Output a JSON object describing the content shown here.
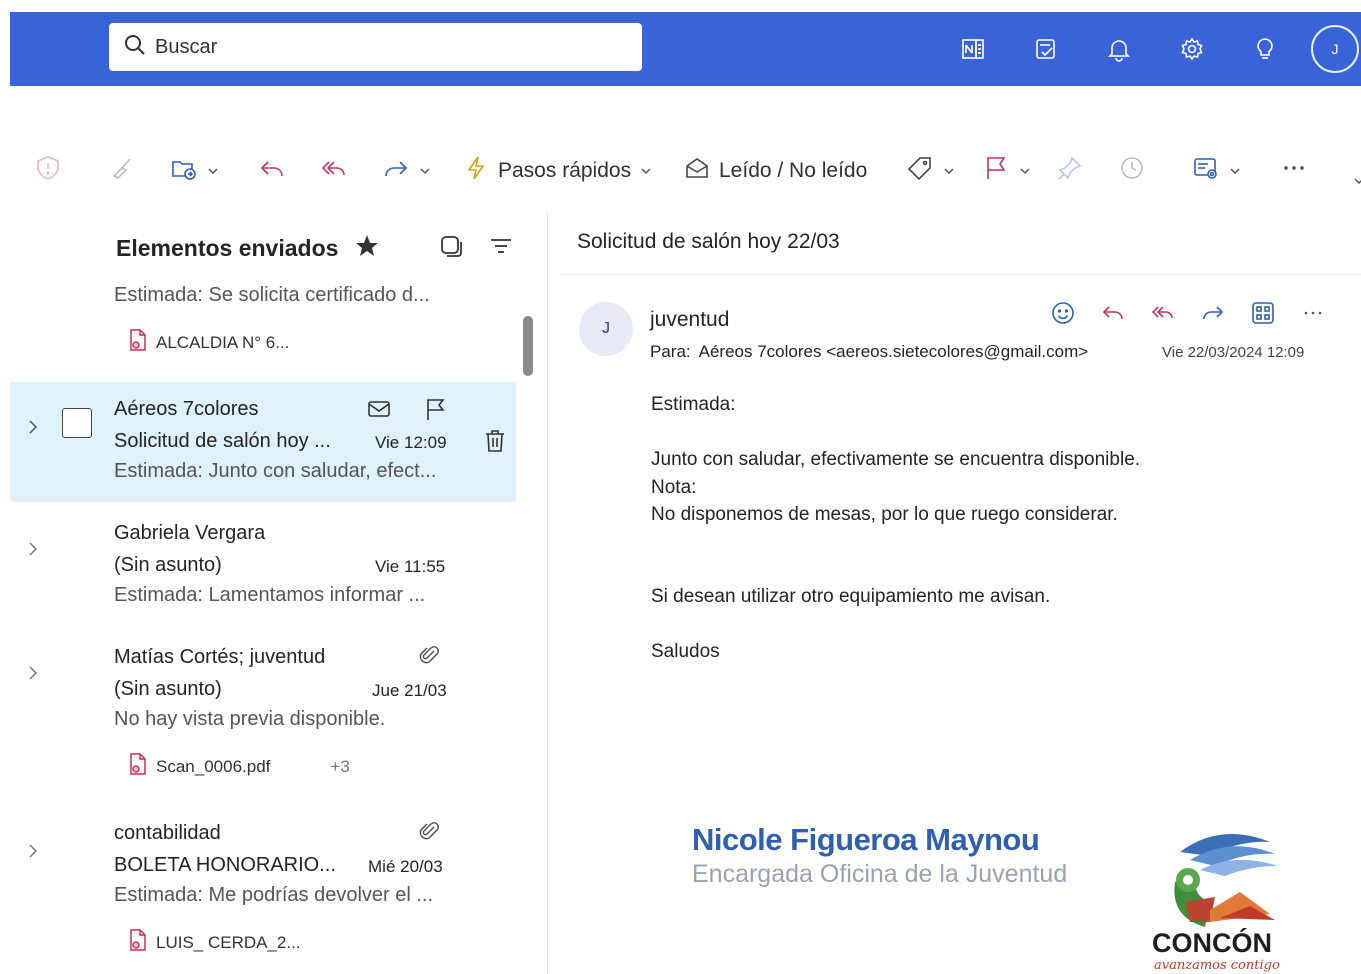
{
  "search": {
    "placeholder": "Buscar"
  },
  "user": {
    "initial": "J"
  },
  "colors": {
    "header_bg": "#3a63d8",
    "selected_row": "#dff1fb",
    "accent_red": "#c6345a",
    "signature_blue": "#2f5fb0"
  },
  "toolbar": {
    "quick_steps_label": "Pasos rápidos",
    "read_unread_label": "Leído / No leído"
  },
  "folder": {
    "title": "Elementos enviados"
  },
  "messages": [
    {
      "preview": "Estimada: Se solicita certificado d...",
      "attachment": "ALCALDIA N° 6..."
    },
    {
      "sender": "Aéreos 7colores",
      "subject": "Solicitud de salón hoy ...",
      "time": "Vie 12:09",
      "preview": "Estimada: Junto con saludar, efect..."
    },
    {
      "sender": "Gabriela Vergara",
      "subject": "(Sin asunto)",
      "time": "Vie 11:55",
      "preview": "Estimada: Lamentamos informar ..."
    },
    {
      "sender": "Matías Cortés; juventud",
      "subject": "(Sin asunto)",
      "time": "Jue 21/03",
      "preview": "No hay vista previa disponible.",
      "attachment": "Scan_0006.pdf",
      "more_attachments": "+3"
    },
    {
      "sender": "contabilidad",
      "subject": "BOLETA HONORARIO...",
      "time": "Mié 20/03",
      "preview": "Estimada: Me podrías devolver el ...",
      "attachment": "LUIS_ CERDA_2..."
    }
  ],
  "reading": {
    "subject": "Solicitud de salón hoy 22/03",
    "avatar_initial": "J",
    "from": "juventud",
    "to_label": "Para:",
    "to": "Aéreos 7colores <aereos.sietecolores@gmail.com>",
    "date": "Vie 22/03/2024 12:09",
    "body": {
      "greeting": "Estimada:",
      "line1": "Junto con saludar, efectivamente se encuentra disponible.",
      "line2": "Nota:",
      "line3": "No disponemos de mesas, por lo que ruego considerar.",
      "line4": "Si desean utilizar otro equipamiento me avisan.",
      "closing": "Saludos"
    },
    "signature": {
      "name": "Nicole Figueroa Maynou",
      "role": "Encargada Oficina de la Juventud",
      "logo_text": "CONCÓN",
      "logo_tagline": "avanzamos contigo"
    }
  }
}
